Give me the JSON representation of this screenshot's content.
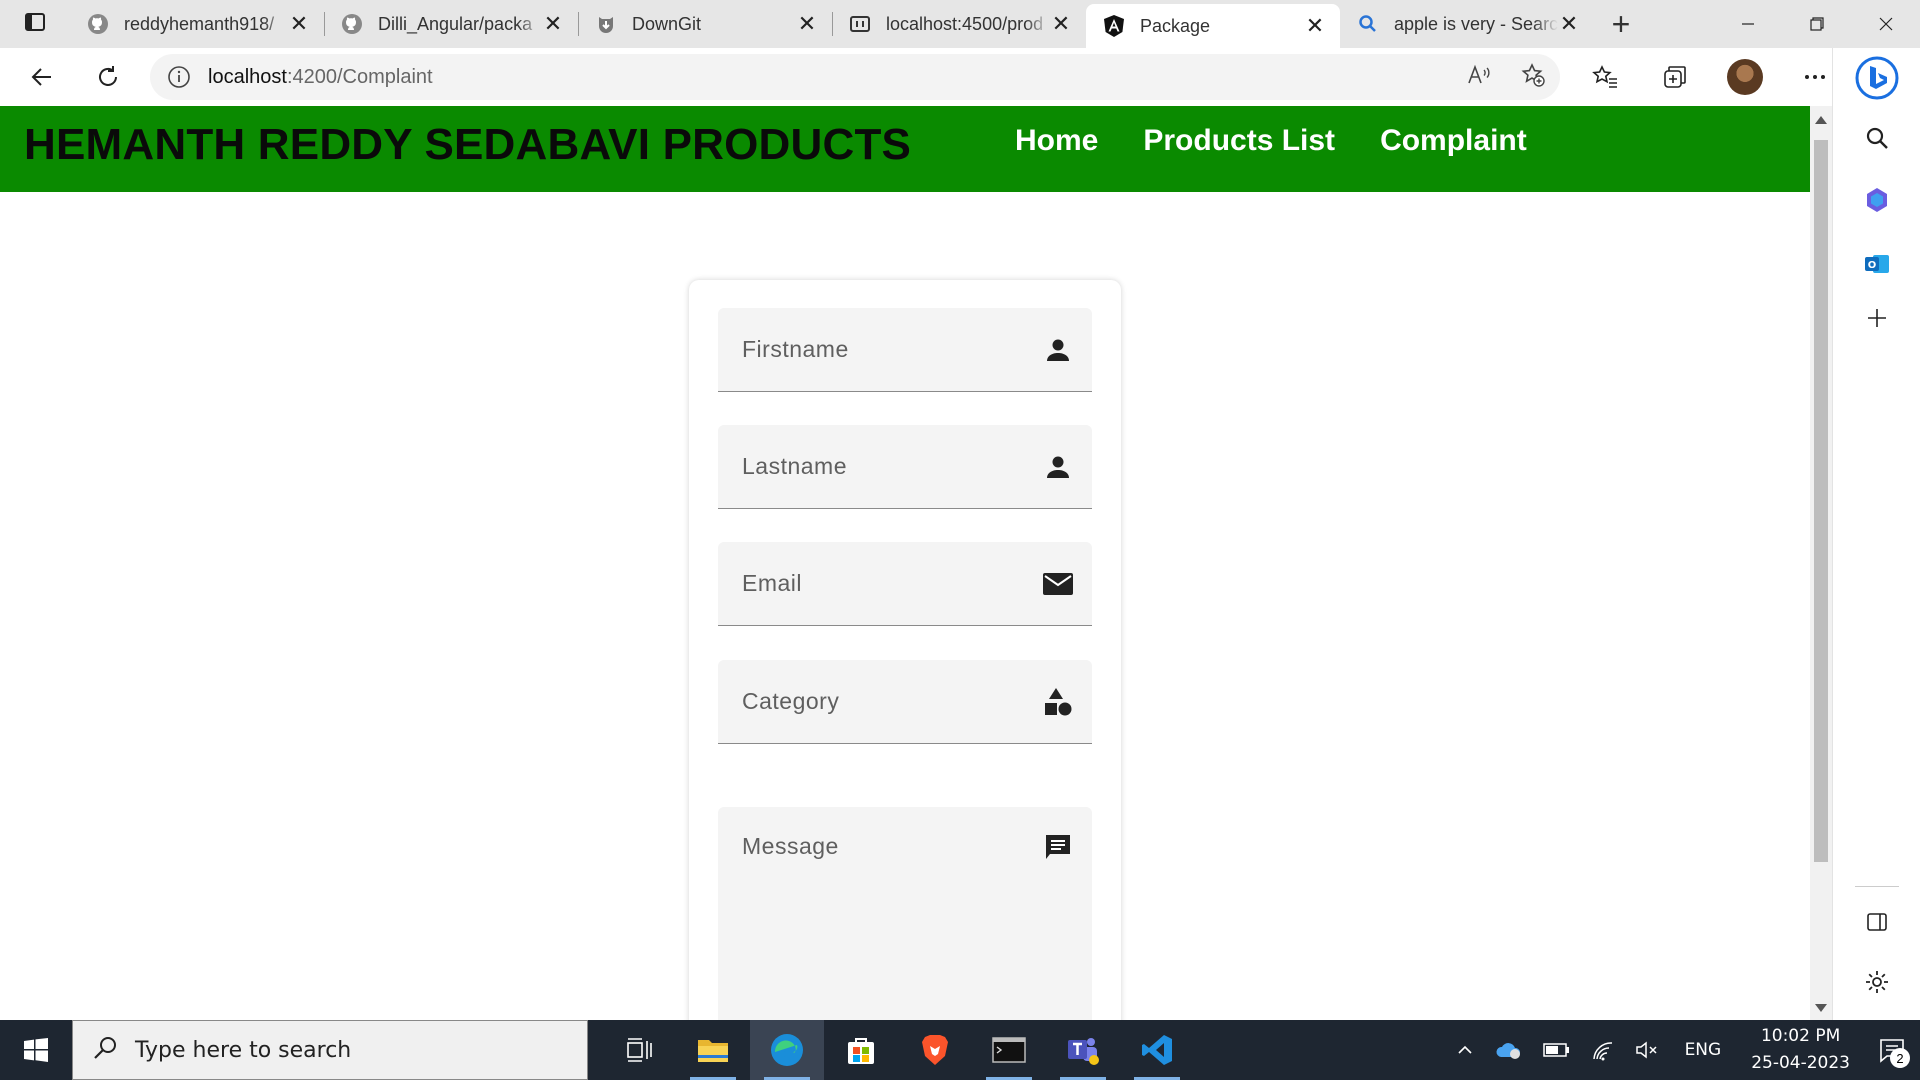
{
  "browser": {
    "tabs": [
      {
        "title": "reddyhemanth918/",
        "icon": "github-icon",
        "active": false
      },
      {
        "title": "Dilli_Angular/packa",
        "icon": "github-icon",
        "active": false
      },
      {
        "title": "DownGit",
        "icon": "downgit-icon",
        "active": false
      },
      {
        "title": "localhost:4500/prod",
        "icon": "page-icon",
        "active": false
      },
      {
        "title": "Package",
        "icon": "angular-icon",
        "active": true
      },
      {
        "title": "apple is very - Searc",
        "icon": "bing-search-icon",
        "active": false
      }
    ],
    "address": {
      "host": "localhost",
      "path": ":4200/Complaint"
    }
  },
  "site": {
    "brand": "HEMANTH REDDY SEDABAVI PRODUCTS",
    "nav": [
      {
        "label": "Home"
      },
      {
        "label": "Products List"
      },
      {
        "label": "Complaint"
      }
    ],
    "colors": {
      "navbar": "#0a8a00",
      "nav_text": "#ffffff",
      "brand_text": "#0a0a0a"
    }
  },
  "form": {
    "firstname": {
      "placeholder": "Firstname",
      "icon": "person-icon"
    },
    "lastname": {
      "placeholder": "Lastname",
      "icon": "person-icon"
    },
    "email": {
      "placeholder": "Email",
      "icon": "mail-icon"
    },
    "category": {
      "placeholder": "Category",
      "icon": "category-icon"
    },
    "message": {
      "placeholder": "Message",
      "icon": "message-icon"
    }
  },
  "taskbar": {
    "search_placeholder": "Type here to search",
    "language": "ENG",
    "time": "10:02 PM",
    "date": "25-04-2023",
    "notification_count": "2"
  }
}
